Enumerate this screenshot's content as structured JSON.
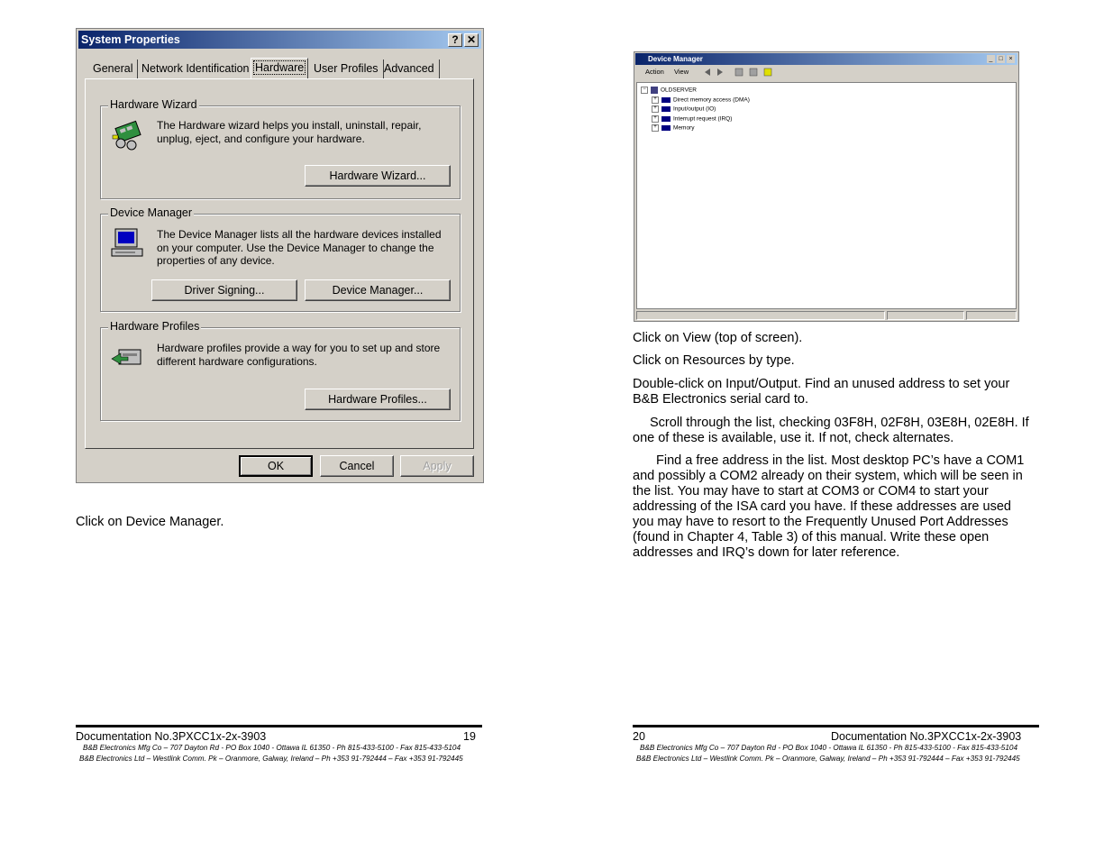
{
  "left_page": {
    "dialog": {
      "title": "System Properties",
      "title_buttons": [
        "?",
        "✕"
      ],
      "tabs": [
        "General",
        "Network Identification",
        "Hardware",
        "User Profiles",
        "Advanced"
      ],
      "active_tab": "Hardware",
      "groups": [
        {
          "label": "Hardware Wizard",
          "text": "The Hardware wizard helps you install, uninstall, repair, unplug, eject, and configure your hardware.",
          "buttons": [
            "Hardware Wizard..."
          ],
          "icon": "hardware-wizard-icon"
        },
        {
          "label": "Device Manager",
          "text": "The Device Manager lists all the hardware devices installed on your computer. Use the Device Manager to change the properties of any device.",
          "buttons": [
            "Driver Signing...",
            "Device Manager..."
          ],
          "icon": "computer-icon"
        },
        {
          "label": "Hardware Profiles",
          "text": "Hardware profiles provide a way for you to set up and store different hardware configurations.",
          "buttons": [
            "Hardware Profiles..."
          ],
          "icon": "hardware-profiles-icon"
        }
      ],
      "footer_buttons": [
        "OK",
        "Cancel",
        "Apply"
      ]
    },
    "caption": "Click on Device Manager.",
    "footer": {
      "doc_no": "Documentation No.3PXCC1x-2x-3903",
      "page_no": "19",
      "address1": "B&B Electronics Mfg Co – 707 Dayton Rd - PO Box 1040 - Ottawa IL 61350 - Ph 815-433-5100 - Fax 815-433-5104",
      "address2": "B&B Electronics Ltd – Westlink Comm. Pk – Oranmore, Galway, Ireland – Ph +353 91-792444 – Fax +353 91-792445"
    }
  },
  "right_page": {
    "device_manager": {
      "title": "Device Manager",
      "menu": [
        "Action",
        "View"
      ],
      "tree_root": "OLDSERVER",
      "tree_items": [
        "Direct memory access (DMA)",
        "Input/output (IO)",
        "Interrupt request (IRQ)",
        "Memory"
      ]
    },
    "paragraphs": [
      "Click on View (top of screen).",
      "Click on Resources by type.",
      "Double-click on Input/Output. Find an unused address to set your B&B Electronics serial card to.",
      "Scroll through the list, checking 03F8H, 02F8H, 03E8H, 02E8H. If one of these is available, use it. If not, check alternates.",
      "Find a free address in the list. Most desktop PC’s have a COM1 and possibly a COM2 already on their system, which will be seen in the list. You may have to start at COM3 or COM4 to start your addressing of the ISA card you have. If these addresses are used you may have to resort to the Frequently Unused Port Addresses (found in Chapter 4, Table 3) of this manual. Write these open addresses and IRQ’s down for later reference."
    ],
    "footer": {
      "page_no": "20",
      "doc_no": "Documentation No.3PXCC1x-2x-3903",
      "address1": "B&B Electronics Mfg Co – 707 Dayton Rd - PO Box 1040 - Ottawa IL 61350 - Ph 815-433-5100 - Fax 815-433-5104",
      "address2": "B&B Electronics Ltd – Westlink Comm. Pk – Oranmore, Galway, Ireland – Ph +353 91-792444 – Fax +353 91-792445"
    }
  }
}
